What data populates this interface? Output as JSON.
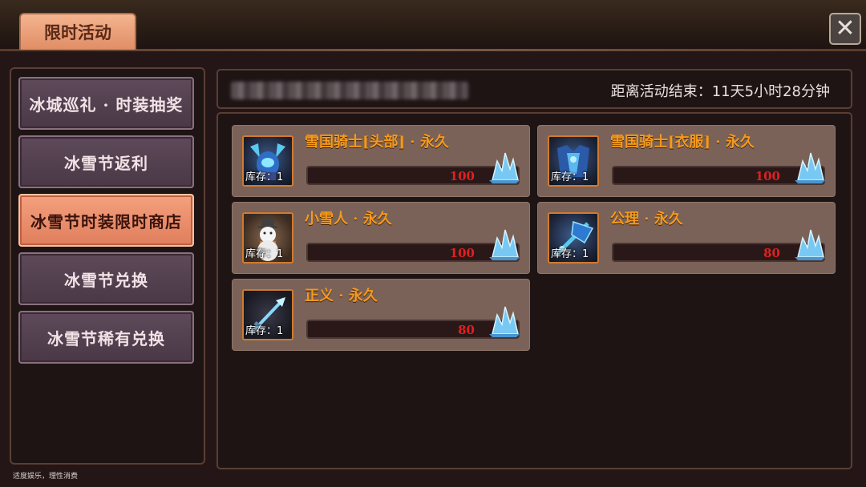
{
  "header": {
    "tab_title": "限时活动",
    "countdown": "距离活动结束：11天5小时28分钟"
  },
  "sidebar": {
    "items": [
      {
        "label": "冰城巡礼 · 时装抽奖",
        "active": false
      },
      {
        "label": "冰雪节返利",
        "active": false
      },
      {
        "label": "冰雪节时装限时商店",
        "active": true
      },
      {
        "label": "冰雪节兑换",
        "active": false
      },
      {
        "label": "冰雪节稀有兑换",
        "active": false
      }
    ]
  },
  "shop": {
    "items": [
      {
        "name": "雪国骑士[头部] · 永久",
        "stock": "库存：1",
        "price": "100",
        "icon": "knight-helmet-icon"
      },
      {
        "name": "雪国骑士[衣服] · 永久",
        "stock": "库存：1",
        "price": "100",
        "icon": "knight-armor-icon"
      },
      {
        "name": "小雪人 · 永久",
        "stock": "库存：1",
        "price": "100",
        "icon": "snowman-icon"
      },
      {
        "name": "公理 · 永久",
        "stock": "库存：1",
        "price": "80",
        "icon": "axiom-weapon-icon"
      },
      {
        "name": "正义 · 永久",
        "stock": "库存：1",
        "price": "80",
        "icon": "justice-sword-icon"
      }
    ],
    "currency_icon": "ice-crystal-icon"
  },
  "footer": {
    "note": "适度娱乐，理性消费"
  },
  "colors": {
    "active_tab": "#e88a66",
    "inactive_tab": "#54404e",
    "item_name": "#f49a1c",
    "price": "#e02020",
    "card_bg": "#7a6258"
  }
}
